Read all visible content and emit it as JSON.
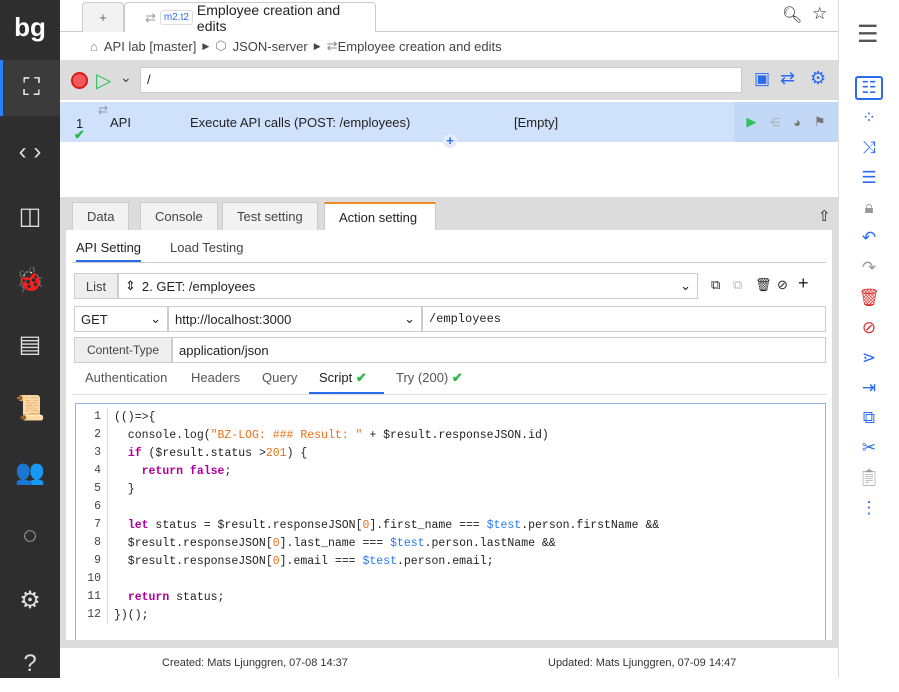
{
  "app": {
    "logo": "bg"
  },
  "left_nav": [
    {
      "name": "hierarchy",
      "icon": "⛶",
      "active": true
    },
    {
      "name": "code-brackets",
      "icon": "‹ ›"
    },
    {
      "name": "components",
      "icon": "◫"
    },
    {
      "name": "bug",
      "icon": "🐞"
    },
    {
      "name": "report",
      "icon": "▤"
    },
    {
      "name": "script",
      "icon": "📜"
    },
    {
      "name": "users",
      "icon": "👥"
    },
    {
      "name": "sync",
      "icon": "◌"
    },
    {
      "name": "settings",
      "icon": "⚙"
    },
    {
      "name": "help",
      "icon": "?"
    }
  ],
  "tabs": {
    "new": "+",
    "active_badge": "m2.t2",
    "active_label": "Employee creation and edits"
  },
  "breadcrumb": [
    "API lab [master]",
    "JSON-server",
    "Employee creation and edits"
  ],
  "toolbar": {
    "path_value": "/"
  },
  "row": {
    "index": "1",
    "type": "API",
    "description": "Execute API calls (POST: /employees)",
    "value": "[Empty]"
  },
  "panel_tabs": [
    "Data",
    "Console",
    "Test setting",
    "Action setting"
  ],
  "sub_tabs": [
    "API Setting",
    "Load Testing"
  ],
  "api": {
    "list_label": "List",
    "list_value": "2. GET: /employees",
    "method": "GET",
    "host": "http://localhost:3000",
    "path": "/employees",
    "content_type_label": "Content-Type",
    "content_type": "application/json"
  },
  "script_tabs": [
    "Authentication",
    "Headers",
    "Query",
    "Script",
    "Try (200)"
  ],
  "code": [
    [
      [
        "(()=>{",
        ""
      ]
    ],
    [
      [
        "  console.log(",
        ""
      ],
      [
        "\"BZ-LOG: ### Result: \"",
        "str"
      ],
      [
        " + $result.responseJSON.id)",
        ""
      ]
    ],
    [
      [
        "  ",
        ""
      ],
      [
        "if",
        "kw"
      ],
      [
        " ($result.status >",
        ""
      ],
      [
        "201",
        "num"
      ],
      [
        ") {",
        ""
      ]
    ],
    [
      [
        "    ",
        ""
      ],
      [
        "return false",
        "kw"
      ],
      [
        ";",
        ""
      ]
    ],
    [
      [
        "  }",
        ""
      ]
    ],
    [
      [
        "",
        ""
      ]
    ],
    [
      [
        "  ",
        ""
      ],
      [
        "let",
        "kw"
      ],
      [
        " status = $result.responseJSON[",
        ""
      ],
      [
        "0",
        "num"
      ],
      [
        "].first_name === ",
        ""
      ],
      [
        "$test",
        "var"
      ],
      [
        ".person.firstName &&",
        ""
      ]
    ],
    [
      [
        "  $result.responseJSON[",
        ""
      ],
      [
        "0",
        "num"
      ],
      [
        "].last_name === ",
        ""
      ],
      [
        "$test",
        "var"
      ],
      [
        ".person.lastName &&",
        ""
      ]
    ],
    [
      [
        "  $result.responseJSON[",
        ""
      ],
      [
        "0",
        "num"
      ],
      [
        "].email === ",
        ""
      ],
      [
        "$test",
        "var"
      ],
      [
        ".person.email;",
        ""
      ]
    ],
    [
      [
        "",
        ""
      ]
    ],
    [
      [
        "  ",
        ""
      ],
      [
        "return",
        "kw"
      ],
      [
        " status;",
        ""
      ]
    ],
    [
      [
        "})();",
        ""
      ]
    ]
  ],
  "footer": {
    "created": "Created: Mats Ljunggren, 07-08 14:37",
    "updated": "Updated: Mats Ljunggren, 07-09 14:47"
  },
  "colors": {
    "accent": "#2a6bf0",
    "selected_row": "#cfe1fb",
    "active_tab": "#f08a24",
    "success": "#2db84b",
    "sidebar": "#2e2e2e"
  }
}
